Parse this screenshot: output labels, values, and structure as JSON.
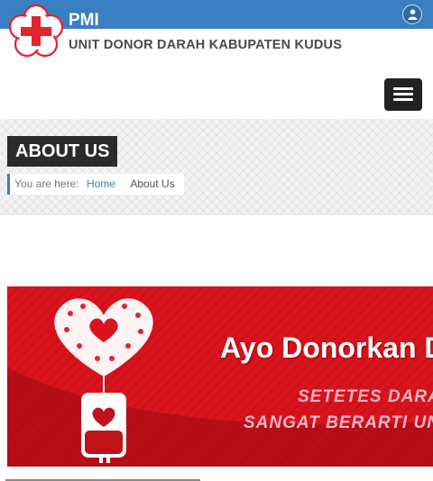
{
  "header": {
    "brand_name": "PMI",
    "brand_subtitle": "UNIT DONOR DARAH KABUPATEN KUDUS",
    "user_icon": "user-icon",
    "menu_icon": "hamburger-icon"
  },
  "page": {
    "title": "ABOUT US",
    "breadcrumb": {
      "prefix": "You are here:",
      "home": "Home",
      "current": "About Us"
    }
  },
  "banner": {
    "title": "Ayo Donorkan Da",
    "line1": "SETETES DARAH",
    "line2": "SANGAT BERARTI UNTUK"
  },
  "colors": {
    "header_blue": "#3a7fc1",
    "logo_red": "#e4232b",
    "title_bg": "#2b2b2b",
    "banner_red": "#d9141e",
    "banner_dark": "#b00d16",
    "banner_pink_text": "#ffb3c4"
  }
}
